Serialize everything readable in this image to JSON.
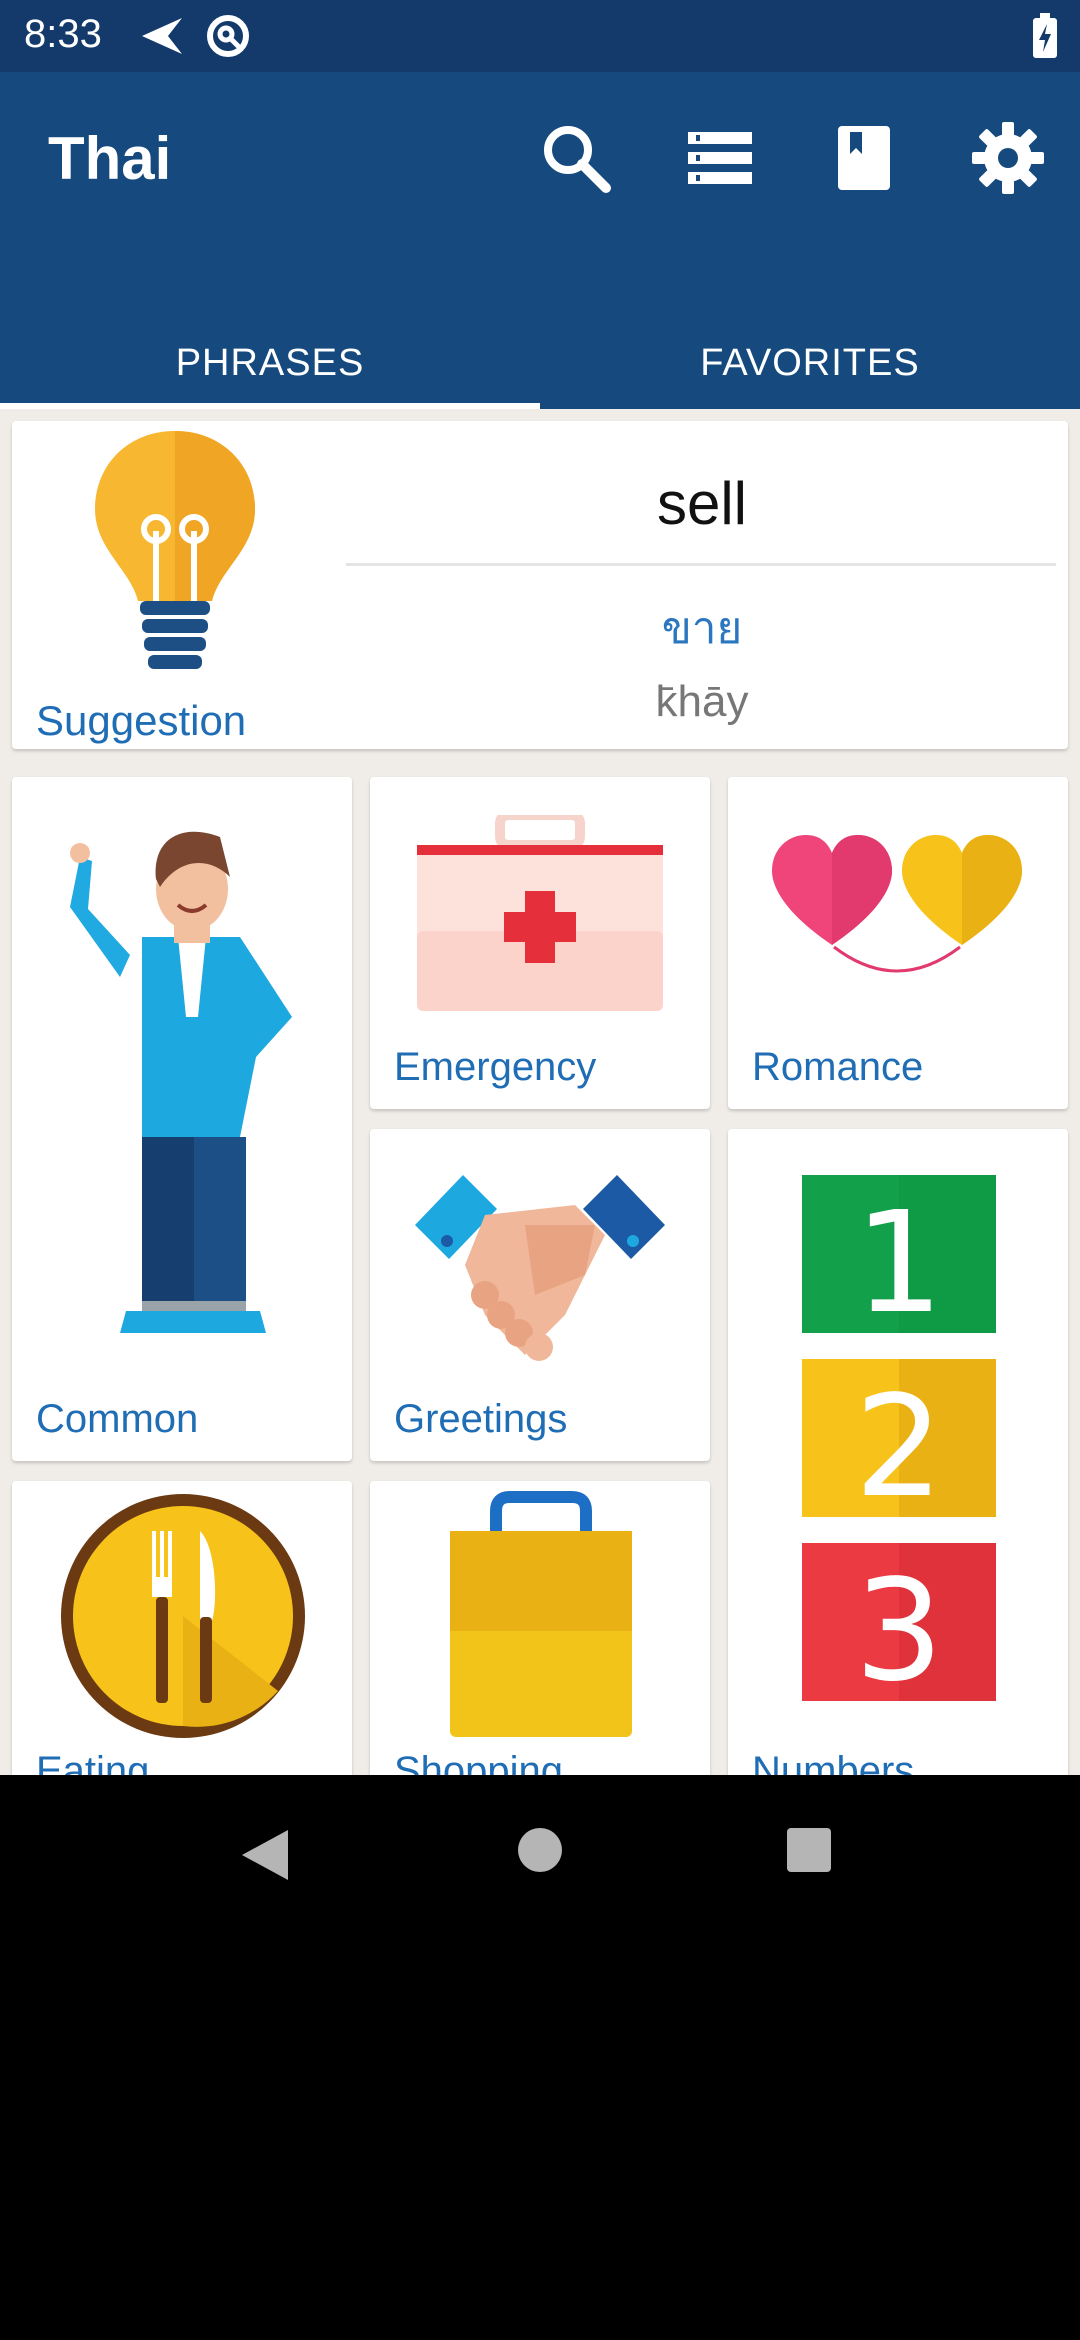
{
  "status_bar": {
    "time": "8:33"
  },
  "app_bar": {
    "title": "Thai",
    "actions": [
      "search-icon",
      "list-icon",
      "book-icon",
      "settings-icon"
    ]
  },
  "tabs": [
    {
      "label": "PHRASES",
      "active": true
    },
    {
      "label": "FAVORITES",
      "active": false
    }
  ],
  "suggestion": {
    "label": "Suggestion",
    "word": "sell",
    "thai": "ขาย",
    "transliteration": "k̄hāy"
  },
  "categories": {
    "common": "Common",
    "emergency": "Emergency",
    "romance": "Romance",
    "greetings": "Greetings",
    "numbers": "Numbers",
    "eating": "Eating",
    "shopping": "Shopping"
  },
  "colors": {
    "status_bar": "#133a6a",
    "app_bar": "#164a7e",
    "accent_text": "#1f6db4",
    "background": "#f0ede8"
  }
}
